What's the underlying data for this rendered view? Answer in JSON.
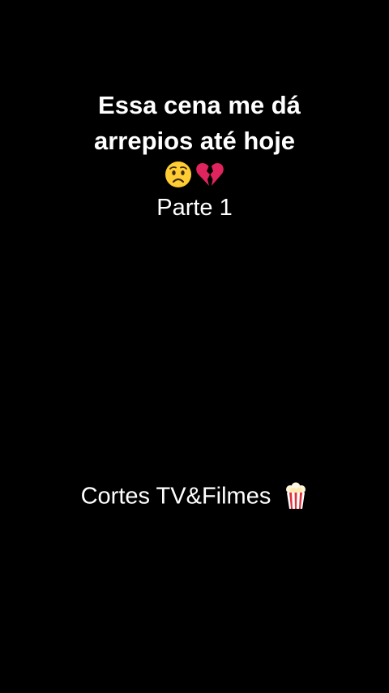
{
  "overlay": {
    "title_line1": "Essa cena me dá",
    "title_line2": "arrepios até hoje",
    "emojis": [
      "worried-face-icon",
      "broken-heart-icon"
    ],
    "subtitle": "Parte 1"
  },
  "watermark": {
    "text": "Cortes TV&Filmes",
    "icon": "popcorn-icon"
  },
  "colors": {
    "background": "#000000",
    "text": "#ffffff"
  }
}
